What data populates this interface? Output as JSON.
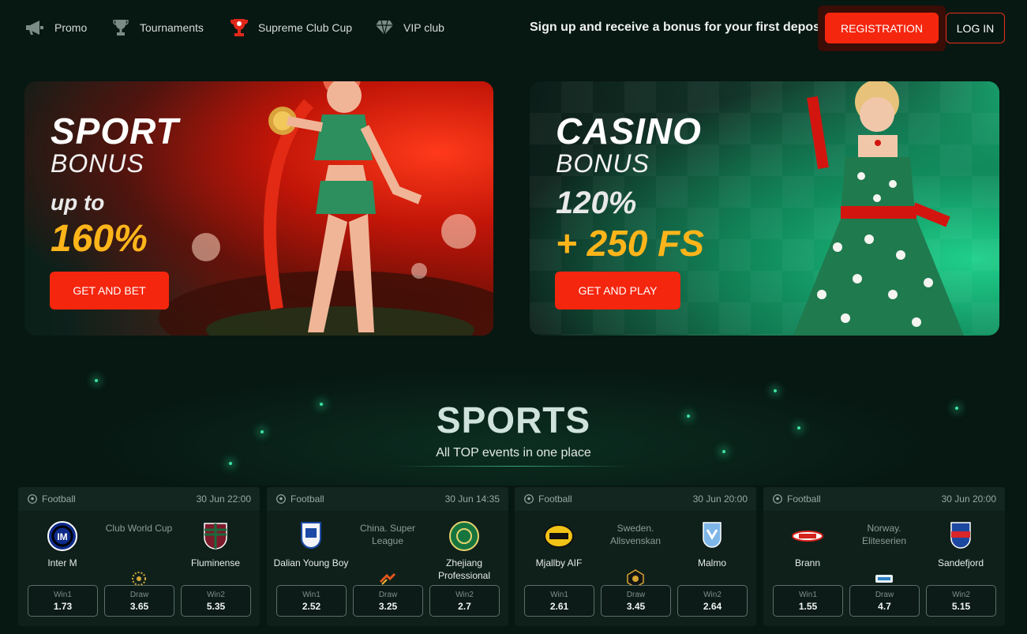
{
  "nav": {
    "items": [
      {
        "label": "Promo",
        "icon": "megaphone-icon"
      },
      {
        "label": "Tournaments",
        "icon": "trophy-icon"
      },
      {
        "label": "Supreme Club Cup",
        "icon": "cup-icon"
      },
      {
        "label": "VIP club",
        "icon": "diamond-icon"
      }
    ],
    "promo_text": "Sign up and receive a bonus for your first deposit",
    "register_label": "REGISTRATION",
    "login_label": "LOG IN"
  },
  "banners": {
    "sport": {
      "title": "SPORT",
      "subtitle": "BONUS",
      "line1": "up to",
      "line2": "160%",
      "button": "GET AND BET"
    },
    "casino": {
      "title": "CASINO",
      "subtitle": "BONUS",
      "line1": "120%",
      "line2": "+ 250 FS",
      "button": "GET AND PLAY"
    }
  },
  "sports": {
    "title": "SPORTS",
    "subtitle": "All TOP events in one place",
    "events": [
      {
        "sport": "Football",
        "datetime": "30 Jun 22:00",
        "home": "Inter M",
        "away": "Fluminense",
        "league": "Club World Cup",
        "odds": [
          {
            "label": "Win1",
            "value": "1.73"
          },
          {
            "label": "Draw",
            "value": "3.65"
          },
          {
            "label": "Win2",
            "value": "5.35"
          }
        ]
      },
      {
        "sport": "Football",
        "datetime": "30 Jun 14:35",
        "home": "Dalian Young Boy",
        "away": "Zhejiang Professional",
        "league": "China. Super League",
        "odds": [
          {
            "label": "Win1",
            "value": "2.52"
          },
          {
            "label": "Draw",
            "value": "3.25"
          },
          {
            "label": "Win2",
            "value": "2.7"
          }
        ]
      },
      {
        "sport": "Football",
        "datetime": "30 Jun 20:00",
        "home": "Mjallby AIF",
        "away": "Malmo",
        "league": "Sweden. Allsvenskan",
        "odds": [
          {
            "label": "Win1",
            "value": "2.61"
          },
          {
            "label": "Draw",
            "value": "3.45"
          },
          {
            "label": "Win2",
            "value": "2.64"
          }
        ]
      },
      {
        "sport": "Football",
        "datetime": "30 Jun 20:00",
        "home": "Brann",
        "away": "Sandefjord",
        "league": "Norway. Eliteserien",
        "odds": [
          {
            "label": "Win1",
            "value": "1.55"
          },
          {
            "label": "Draw",
            "value": "4.7"
          },
          {
            "label": "Win2",
            "value": "5.15"
          }
        ]
      }
    ]
  },
  "colors": {
    "background": "#071712",
    "accent": "#f5260e",
    "bonus_yellow": "#ffb51a",
    "casino_green": "#1bb97c"
  }
}
